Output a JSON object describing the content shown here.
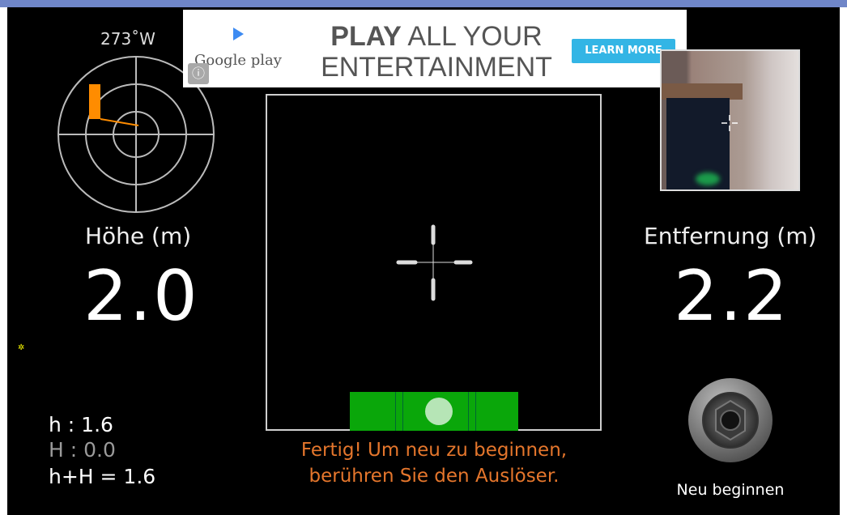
{
  "compass": {
    "heading": "273˚W"
  },
  "ad": {
    "info_glyph": "ⓘ",
    "brand": "Google play",
    "headline_bold": "PLAY",
    "headline_rest": " ALL YOUR",
    "headline_line2": "ENTERTAINMENT",
    "cta": "LEARN MORE"
  },
  "height": {
    "label": "Höhe (m)",
    "value": "2.0"
  },
  "distance": {
    "label": "Entfernung (m)",
    "value": "2.2"
  },
  "stats": {
    "h": "h : 1.6",
    "H": "H : 0.0",
    "sum": "h+H = 1.6"
  },
  "message": {
    "line1": "Fertig! Um neu zu beginnen,",
    "line2": "berühren Sie den Auslöser."
  },
  "shutter": {
    "label": "Neu beginnen"
  },
  "colors": {
    "accent": "#e5762c",
    "level": "#0aa70a",
    "compass_marker": "#ff8c00",
    "ad_cta": "#33b5e5"
  },
  "icons": [
    "compass-radar-icon",
    "crosshair-icon",
    "spirit-level-icon",
    "camera-shutter-icon",
    "info-icon",
    "play-store-icon"
  ]
}
